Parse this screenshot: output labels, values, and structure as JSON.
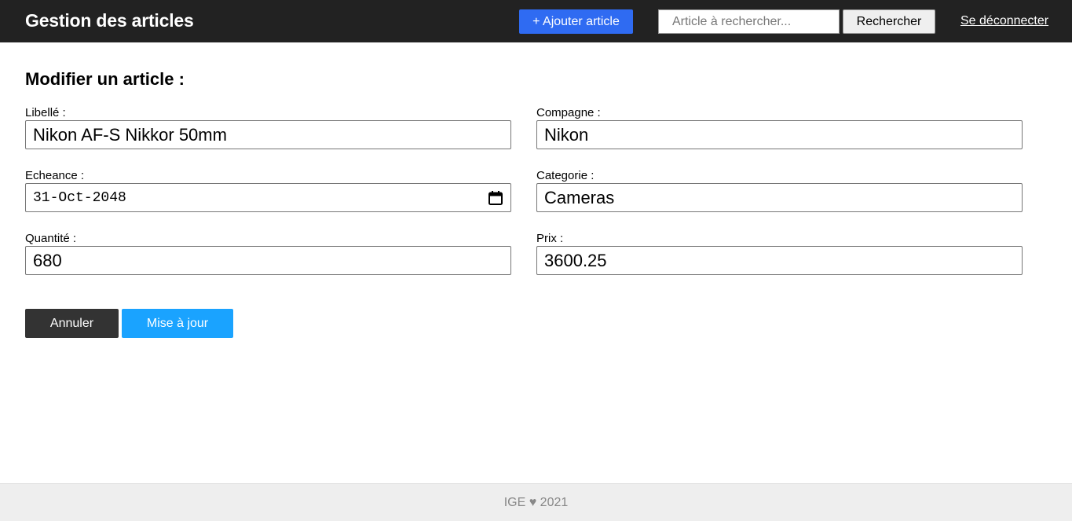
{
  "header": {
    "title": "Gestion des articles",
    "add_button": "+ Ajouter article",
    "search_placeholder": "Article à rechercher...",
    "search_button": "Rechercher",
    "logout": "Se déconnecter"
  },
  "form": {
    "title": "Modifier un article :",
    "libelle": {
      "label": "Libellé :",
      "value": "Nikon AF-S Nikkor 50mm"
    },
    "compagne": {
      "label": "Compagne :",
      "value": "Nikon"
    },
    "echeance": {
      "label": "Echeance :",
      "value": "31-Oct-2048",
      "icon": "calendar-icon"
    },
    "categorie": {
      "label": "Categorie :",
      "value": "Cameras"
    },
    "quantite": {
      "label": "Quantité :",
      "value": "680"
    },
    "prix": {
      "label": "Prix :",
      "value": "3600.25"
    },
    "cancel_button": "Annuler",
    "update_button": "Mise à jour"
  },
  "footer": {
    "text": "IGE ♥ 2021"
  },
  "colors": {
    "topbar": "#222222",
    "add_button": "#2f6bf2",
    "update_button": "#1aa3ff",
    "cancel_button": "#333333",
    "footer_bg": "#eeeeee"
  }
}
